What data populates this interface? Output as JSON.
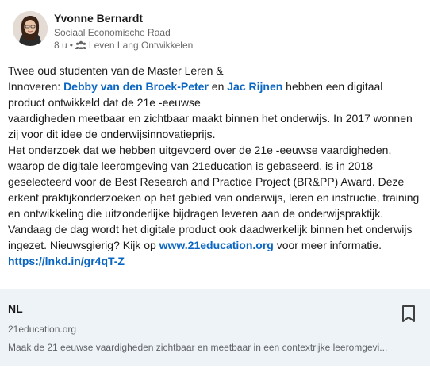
{
  "author": {
    "name": "Yvonne Bernardt",
    "headline": "Sociaal Economische Raad",
    "time": "8 u",
    "separator": "•",
    "audience_icon": "group-icon",
    "group": "Leven Lang Ontwikkelen"
  },
  "post": {
    "p1_a": "Twee oud studenten van de Master Leren &",
    "p1_b": "Innoveren: ",
    "mention1": "Debby van den Broek-Peter",
    "p1_c": " en ",
    "mention2": "Jac Rijnen",
    "p1_d": " hebben een digitaal product ontwikkeld dat de 21e -eeuwse",
    "p2": "vaardigheden meetbaar en zichtbaar maakt binnen het onderwijs. In 2017 wonnen zij voor dit idee de onderwijsinnovatieprijs.",
    "p3": "Het onderzoek dat we hebben uitgevoerd over de 21e -eeuwse vaardigheden, waarop de digitale leeromgeving van 21education is gebaseerd, is in 2018 geselecteerd voor de Best Research and Practice Project (BR&PP) Award. Deze erkent praktijkonderzoeken op het gebied van onderwijs, leren en instructie, training en ontwikkeling die uitzonderlijke bijdragen leveren aan de onderwijspraktijk.",
    "p4_a": "Vandaag de dag wordt het digitale product ook daadwerkelijk binnen het onderwijs ingezet. Nieuwsgierig? Kijk op ",
    "link1": "www.21education.org",
    "p4_b": " voor meer informatie.",
    "link2": "https://lnkd.in/gr4qT-Z"
  },
  "link_card": {
    "title": "NL",
    "domain": "21education.org",
    "description": "Maak de 21 eeuwse vaardigheden zichtbaar en meetbaar in een contextrijke leeromgevi...",
    "bookmark_icon": "bookmark-icon"
  },
  "colors": {
    "link": "#0a66c2",
    "card_bg": "#eef3f8",
    "secondary_text": "#666666"
  }
}
